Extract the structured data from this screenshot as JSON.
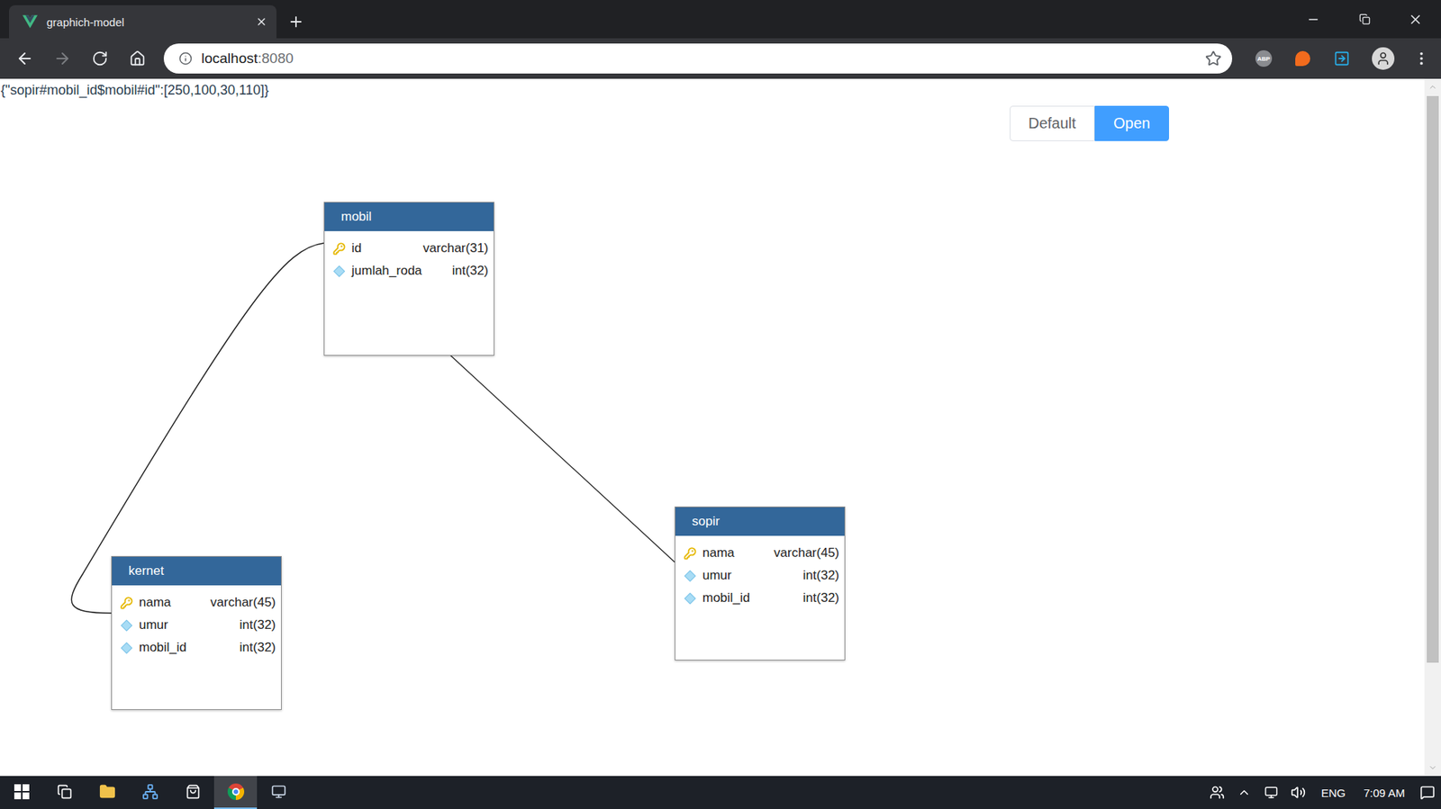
{
  "browser": {
    "tabs": [
      {
        "label": "graphich-model",
        "selected": true
      }
    ],
    "nav": {
      "back_disabled": false,
      "forward_disabled": true
    },
    "address": {
      "host": "localhost",
      "port": ":8080"
    },
    "adblock_badge": "ABP"
  },
  "page": {
    "output": "{\"sopir#mobil_id$mobil#id\":[250,100,30,110]}",
    "buttons": [
      {
        "label": "Default",
        "selected": false
      },
      {
        "label": "Open",
        "selected": true
      }
    ],
    "tables": [
      {
        "name": "mobil",
        "columns": [
          {
            "name": "id",
            "type": "varchar(31)",
            "key": true
          },
          {
            "name": "jumlah_roda",
            "type": "int(32)",
            "key": false
          }
        ]
      },
      {
        "name": "sopir",
        "columns": [
          {
            "name": "nama",
            "type": "varchar(45)",
            "key": true
          },
          {
            "name": "umur",
            "type": "int(32)",
            "key": false
          },
          {
            "name": "mobil_id",
            "type": "int(32)",
            "key": false
          }
        ]
      },
      {
        "name": "kernet",
        "columns": [
          {
            "name": "nama",
            "type": "varchar(45)",
            "key": true
          },
          {
            "name": "umur",
            "type": "int(32)",
            "key": false
          },
          {
            "name": "mobil_id",
            "type": "int(32)",
            "key": false
          }
        ]
      }
    ]
  },
  "taskbar": {
    "apps": [
      {
        "selected": false
      },
      {
        "selected": false
      },
      {
        "selected": false
      },
      {
        "selected": false
      },
      {
        "selected": false
      },
      {
        "selected": true
      },
      {
        "selected": false
      }
    ],
    "language": "ENG",
    "time": "7:09 AM"
  }
}
